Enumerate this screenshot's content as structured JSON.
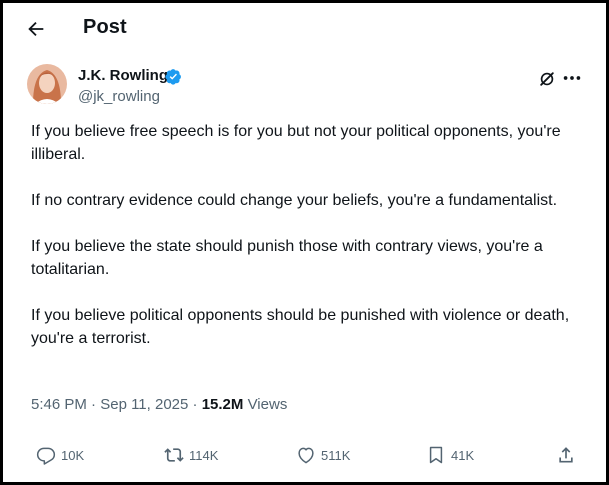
{
  "header": {
    "title": "Post"
  },
  "author": {
    "name": "J.K. Rowling",
    "handle": "@jk_rowling"
  },
  "tweet": {
    "paragraphs": [
      "If you believe free speech is for you but not your political opponents, you're illiberal.",
      "If no contrary evidence could change your beliefs, you're a fundamentalist.",
      "If you believe the state should punish those with contrary views, you're a totalitarian.",
      "If you believe political opponents should be punished with violence or death, you're a terrorist."
    ]
  },
  "meta": {
    "time": "5:46 PM",
    "date": "Sep 11, 2025",
    "views_count": "15.2M",
    "views_label": "Views"
  },
  "actions": {
    "replies": "10K",
    "reposts": "114K",
    "likes": "511K",
    "bookmarks": "41K"
  },
  "colors": {
    "verified": "#1d9bf0",
    "muted": "#536471",
    "text": "#0f1419"
  },
  "icons": [
    "back-arrow-icon",
    "verified-badge-icon",
    "grok-icon",
    "more-icon",
    "reply-icon",
    "repost-icon",
    "like-icon",
    "bookmark-icon",
    "share-icon"
  ]
}
